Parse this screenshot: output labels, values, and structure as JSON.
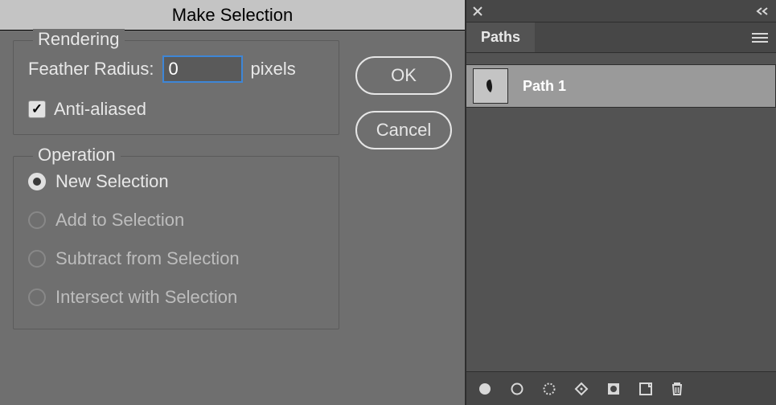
{
  "dialog": {
    "title": "Make Selection",
    "rendering": {
      "legend": "Rendering",
      "feather_label": "Feather Radius:",
      "feather_value": "0",
      "feather_unit": "pixels",
      "antialias_checked": true,
      "antialias_label": "Anti-aliased"
    },
    "operation": {
      "legend": "Operation",
      "options": [
        {
          "label": "New Selection",
          "selected": true,
          "enabled": true
        },
        {
          "label": "Add to Selection",
          "selected": false,
          "enabled": false
        },
        {
          "label": "Subtract from Selection",
          "selected": false,
          "enabled": false
        },
        {
          "label": "Intersect with Selection",
          "selected": false,
          "enabled": false
        }
      ]
    },
    "buttons": {
      "ok": "OK",
      "cancel": "Cancel"
    }
  },
  "panel": {
    "tab": "Paths",
    "items": [
      {
        "name": "Path 1"
      }
    ]
  }
}
